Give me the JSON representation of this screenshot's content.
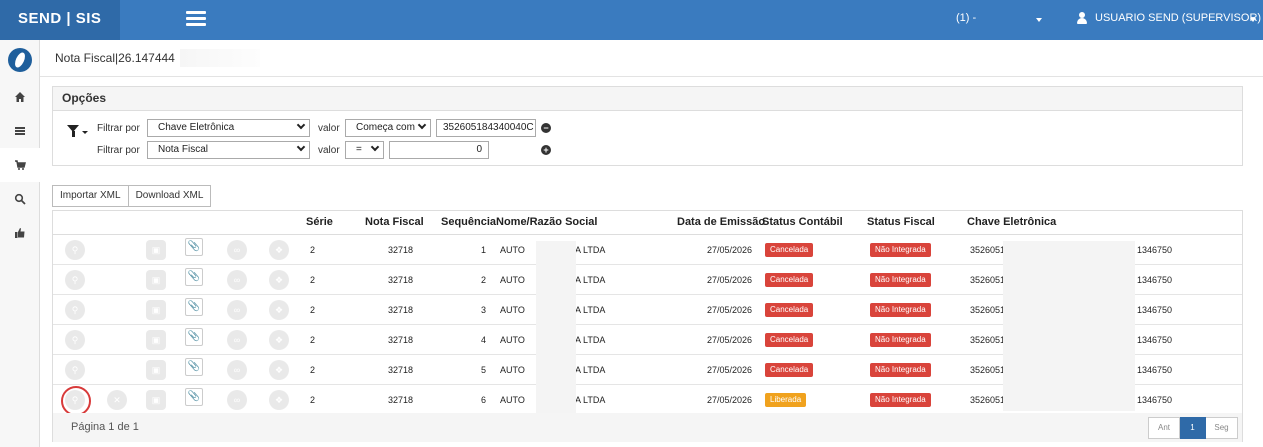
{
  "app": {
    "brand": "SEND | SIS",
    "company": "(1) -",
    "user": "USUARIO SEND (SUPERVISOR)"
  },
  "sidebar": {
    "items": [
      "home-icon",
      "list-icon",
      "cart-icon",
      "search-icon",
      "thumbs-up-icon"
    ],
    "active_index": 2
  },
  "breadcrumb": "Nota Fiscal|26.147444",
  "options": {
    "title": "Opções",
    "filter_by_label": "Filtrar por",
    "value_label": "valor",
    "row1": {
      "field": "Chave Eletrônica",
      "operator": "Começa com",
      "value": "352605184340040C"
    },
    "row2": {
      "field": "Nota Fiscal",
      "operator": "=",
      "value": "0"
    }
  },
  "actions": {
    "import_label": "Importar XML",
    "download_label": "Download XML"
  },
  "table": {
    "headers": [
      "Série",
      "Nota Fiscal",
      "Sequência",
      "Nome/Razão Social",
      "Data de Emissão",
      "Status Contábil",
      "Status Fiscal",
      "Chave Eletrônica"
    ],
    "rows": [
      {
        "serie": "2",
        "nota": "32718",
        "seq": "1",
        "nome_a": "AUTO",
        "nome_b": "A LTDA",
        "data": "27/05/2026",
        "contabil": "Cancelada",
        "fiscal": "Não Integrada",
        "chave_a": "35260518",
        "chave_b": "1346750"
      },
      {
        "serie": "2",
        "nota": "32718",
        "seq": "2",
        "nome_a": "AUTO",
        "nome_b": "A LTDA",
        "data": "27/05/2026",
        "contabil": "Cancelada",
        "fiscal": "Não Integrada",
        "chave_a": "35260518",
        "chave_b": "1346750"
      },
      {
        "serie": "2",
        "nota": "32718",
        "seq": "3",
        "nome_a": "AUTO",
        "nome_b": "A LTDA",
        "data": "27/05/2026",
        "contabil": "Cancelada",
        "fiscal": "Não Integrada",
        "chave_a": "35260518",
        "chave_b": "1346750"
      },
      {
        "serie": "2",
        "nota": "32718",
        "seq": "4",
        "nome_a": "AUTO",
        "nome_b": "A LTDA",
        "data": "27/05/2026",
        "contabil": "Cancelada",
        "fiscal": "Não Integrada",
        "chave_a": "35260518",
        "chave_b": "1346750"
      },
      {
        "serie": "2",
        "nota": "32718",
        "seq": "5",
        "nome_a": "AUTO",
        "nome_b": "A LTDA",
        "data": "27/05/2026",
        "contabil": "Cancelada",
        "fiscal": "Não Integrada",
        "chave_a": "35260518",
        "chave_b": "1346750"
      },
      {
        "serie": "2",
        "nota": "32718",
        "seq": "6",
        "nome_a": "AUTO",
        "nome_b": "A LTDA",
        "data": "27/05/2026",
        "contabil": "Liberada",
        "fiscal": "Não Integrada",
        "chave_a": "35260518",
        "chave_b": "1346750"
      }
    ]
  },
  "pagination": {
    "info": "Página 1 de 1",
    "prev": "Ant",
    "current": "1",
    "next": "Seg"
  },
  "colors": {
    "topbar": "#3a7bbf",
    "brand_bg": "#2f6aa8",
    "cancelada": "#d9443b",
    "liberada": "#f0a21e",
    "nao_integrada": "#d9443b",
    "highlight": "#d83a3a"
  }
}
